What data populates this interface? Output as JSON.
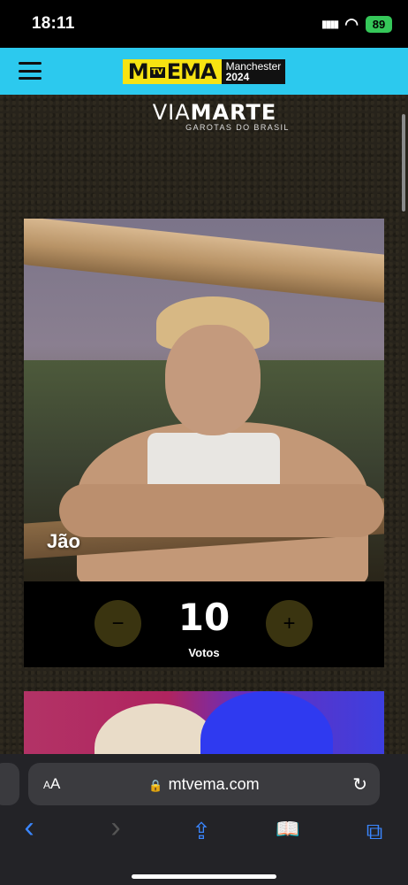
{
  "status_bar": {
    "time": "18:11",
    "signal": "▮▮▮▮",
    "wifi": "◠",
    "battery": "89"
  },
  "header": {
    "logo_m": "M",
    "logo_tv": "TV",
    "logo_ema": "EMA",
    "logo_city": "Manchester",
    "logo_year": "2024"
  },
  "sponsor": {
    "name_light": "VIA",
    "name_bold": "MARTE",
    "subtitle": "GAROTAS DO BRASIL"
  },
  "card": {
    "artist_name": "Jão",
    "minus_label": "−",
    "plus_label": "+",
    "vote_count": "10",
    "votes_label": "Votos"
  },
  "browser": {
    "aa_label_small": "A",
    "aa_label": "A",
    "lock_icon": "🔒",
    "url": "mtvema.com",
    "reload_icon": "↻",
    "back_icon": "‹",
    "forward_icon": "›",
    "share_icon": "⇪",
    "bookmarks_icon": "📖",
    "tabs_icon": "⧉"
  }
}
